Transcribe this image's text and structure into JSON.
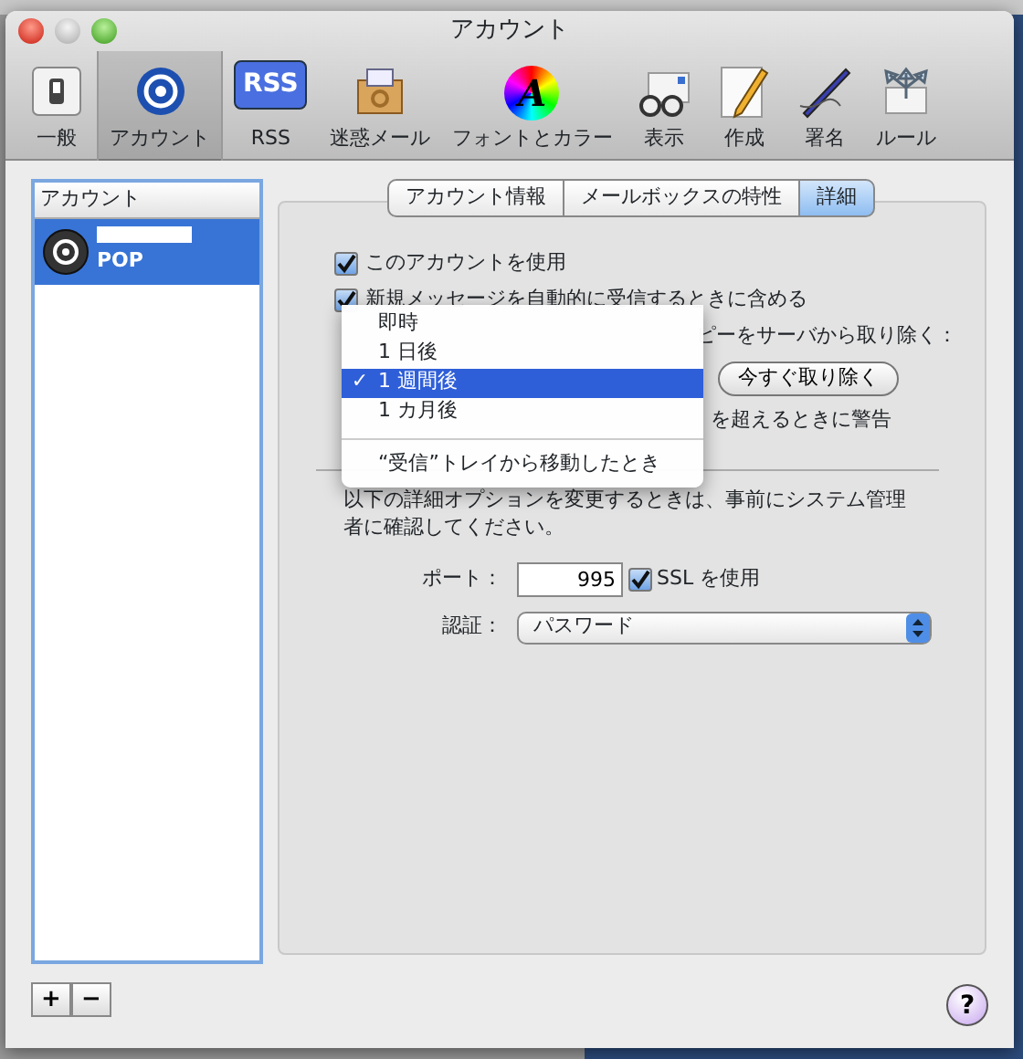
{
  "window": {
    "title": "アカウント"
  },
  "toolbar": {
    "items": [
      {
        "label": "一般",
        "selected": false
      },
      {
        "label": "アカウント",
        "selected": true
      },
      {
        "label": "RSS",
        "selected": false,
        "badge_text": "RSS"
      },
      {
        "label": "迷惑メール",
        "selected": false
      },
      {
        "label": "フォントとカラー",
        "selected": false,
        "badge_text": "A"
      },
      {
        "label": "表示",
        "selected": false
      },
      {
        "label": "作成",
        "selected": false
      },
      {
        "label": "署名",
        "selected": false
      },
      {
        "label": "ルール",
        "selected": false
      }
    ]
  },
  "sidebar": {
    "header": "アカウント",
    "accounts": [
      {
        "type": "POP",
        "selected": true
      }
    ],
    "add_button": "+",
    "remove_button": "−"
  },
  "tabs": [
    {
      "label": "アカウント情報",
      "selected": false
    },
    {
      "label": "メールボックスの特性",
      "selected": false
    },
    {
      "label": "詳細",
      "selected": true
    }
  ],
  "options": [
    {
      "label": "このアカウントを使用",
      "checked": true
    },
    {
      "label": "新規メッセージを自動的に受信するときに含める",
      "checked": true
    }
  ],
  "remove_copy": {
    "label_visible_part": "ピーをサーバから取り除く：",
    "button": "今すぐ取り除く"
  },
  "quota_warning": {
    "label_visible_part": "を超えるときに警告"
  },
  "popup_menu": {
    "items": [
      {
        "kind": "item",
        "label": "即時",
        "selected": false
      },
      {
        "kind": "item",
        "label": "1 日後",
        "selected": false
      },
      {
        "kind": "item",
        "label": "1 週間後",
        "selected": true
      },
      {
        "kind": "item",
        "label": "1 カ月後",
        "selected": false
      },
      {
        "kind": "separator"
      },
      {
        "kind": "item",
        "label": "“受信”トレイから移動したとき",
        "selected": false
      }
    ],
    "check_mark": "✓"
  },
  "advanced_note": "以下の詳細オプションを変更するときは、事前にシステム管理者に確認してください。",
  "port": {
    "label": "ポート：",
    "value": "995"
  },
  "ssl": {
    "label": "SSL を使用",
    "checked": true
  },
  "auth": {
    "label": "認証：",
    "value": "パスワード"
  },
  "help_button": "?"
}
